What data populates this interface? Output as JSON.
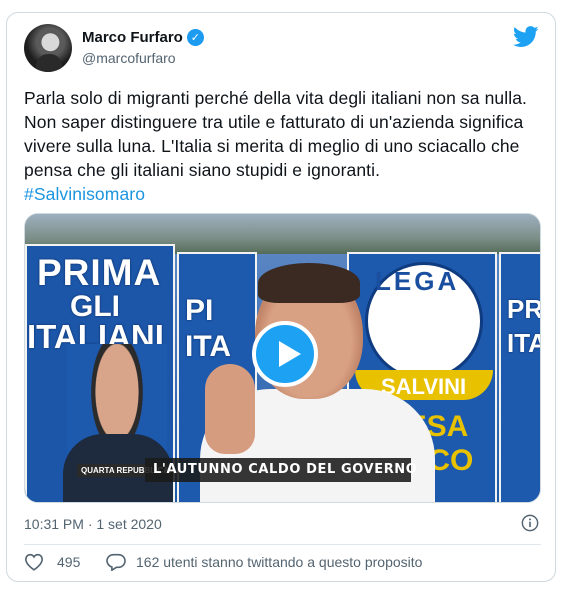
{
  "author": {
    "display_name": "Marco Furfaro",
    "handle": "@marcofurfaro",
    "verified_icon": "verified-badge-icon",
    "platform_icon": "twitter-bird-icon"
  },
  "tweet": {
    "text": "Parla solo di migranti perché della vita degli italiani non sa nulla. Non saper distinguere tra utile e fatturato di un'azienda significa vivere sulla luna. L'Italia si merita di meglio di uno sciacallo che pensa che gli italiani siano stupidi e ignoranti.",
    "hashtag": "#Salvinisomaro"
  },
  "media": {
    "type": "video",
    "posters": {
      "left_line1": "PRIMA",
      "left_line2": "GLI",
      "left_line3": "ITALIANI",
      "mid_line1": "PI",
      "mid_line2": "ITA",
      "lega_word": "LEGA",
      "salvini_word": "SALVINI",
      "yellow_line1": "RESA",
      "yellow_line2": "DACO",
      "right_line1": "PRI",
      "right_line2": "ITA"
    },
    "lower_third": "L'AUTUNNO CALDO DEL GOVERNO",
    "channel_logo": "QUARTA REPUBBLICA",
    "play_icon": "play-button-icon"
  },
  "meta": {
    "timestamp": "10:31 PM · 1 set 2020",
    "info_icon": "info-icon"
  },
  "actions": {
    "likes": "495",
    "conversation": "162 utenti stanno twittando a questo proposito"
  },
  "colors": {
    "accent": "#1da1f2",
    "hashtag": "#1b95e0",
    "muted_text": "#536471",
    "border": "#cfd9de"
  }
}
